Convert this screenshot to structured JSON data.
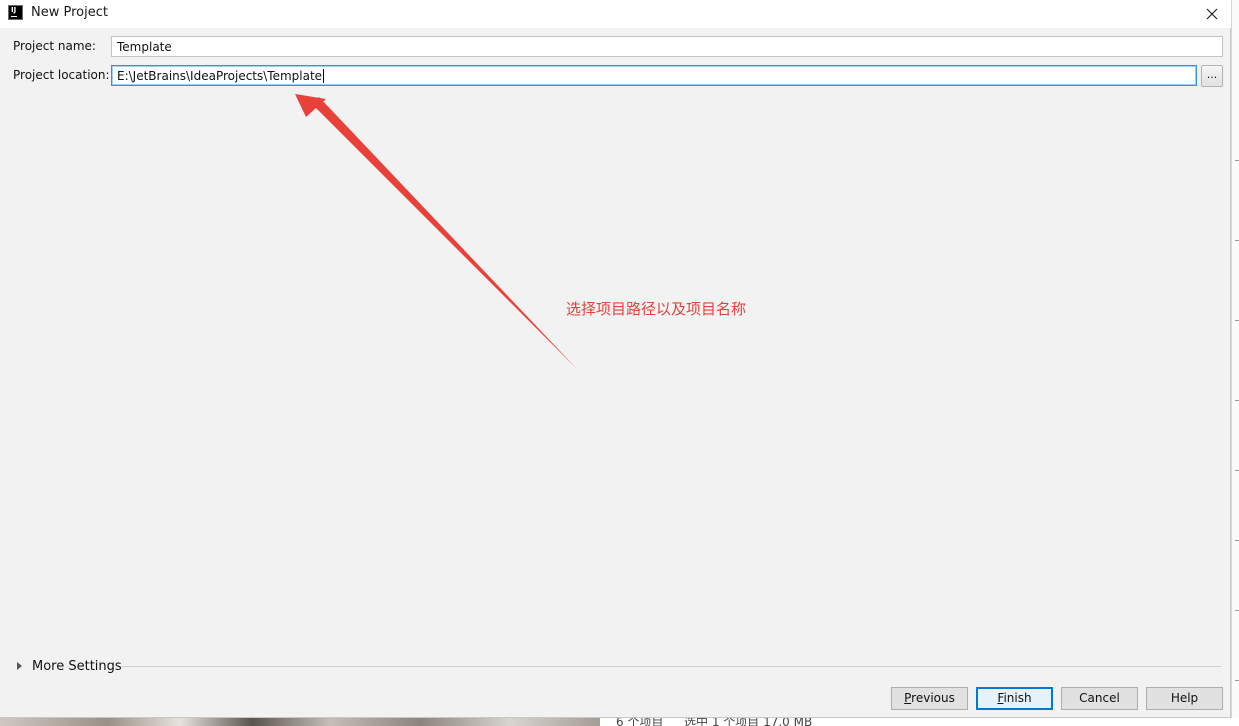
{
  "window": {
    "title": "New Project",
    "app_icon_label": "IJ"
  },
  "form": {
    "project_name_label": "Project name:",
    "project_name_value": "Template",
    "project_location_label": "Project location:",
    "project_location_value": "E:\\JetBrains\\IdeaProjects\\Template",
    "browse_label": "..."
  },
  "annotation": {
    "text": "选择项目路径以及项目名称",
    "color": "#e8413a"
  },
  "more_settings": {
    "label": "More Settings"
  },
  "buttons": {
    "previous": {
      "mnemonic": "P",
      "rest": "revious"
    },
    "finish": {
      "mnemonic": "F",
      "rest": "inish"
    },
    "cancel": "Cancel",
    "help": "Help"
  },
  "background_explorer": {
    "item_count": "6 个项目",
    "selected_info": "选中 1 个项目 17.0 MB"
  },
  "colors": {
    "accent": "#0078d7",
    "focus_border": "#3d8fd6",
    "dialog_bg": "#f2f2f2"
  }
}
